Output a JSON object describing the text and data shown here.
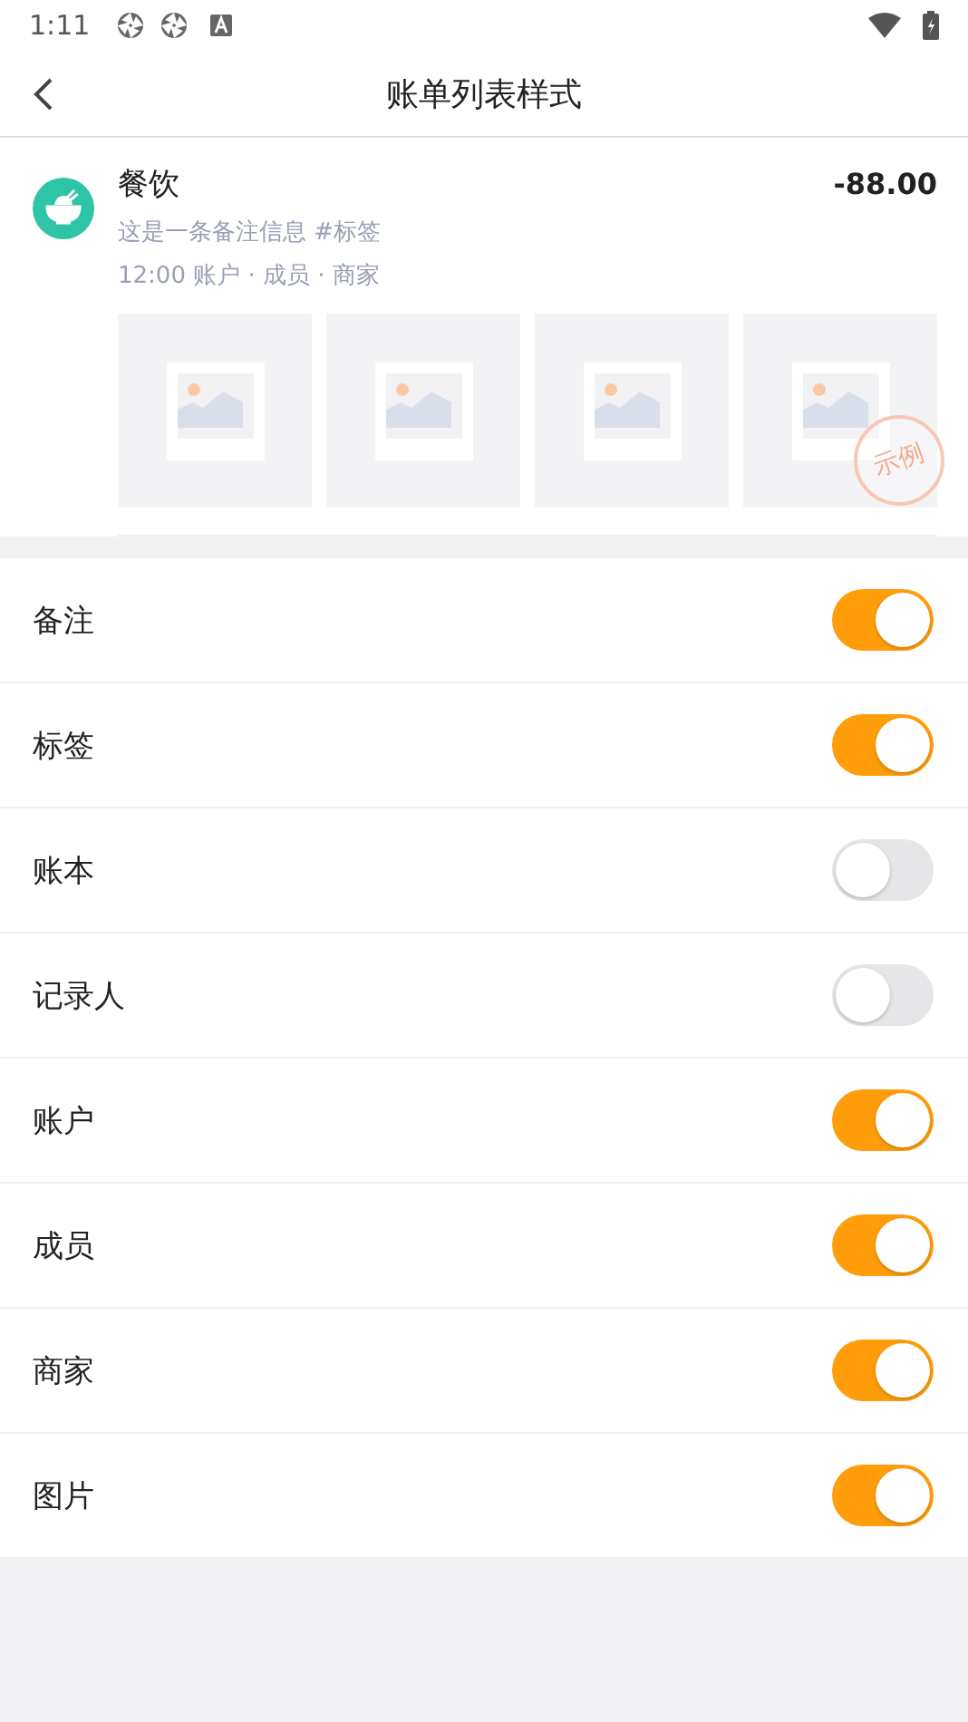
{
  "status_bar": {
    "time": "1:11"
  },
  "header": {
    "title": "账单列表样式"
  },
  "preview": {
    "category": "餐饮",
    "amount": "-88.00",
    "note": "这是一条备注信息 #标签",
    "meta": "12:00 账户 · 成员 · 商家",
    "stamp": "示例"
  },
  "settings": [
    {
      "label": "备注",
      "on": true
    },
    {
      "label": "标签",
      "on": true
    },
    {
      "label": "账本",
      "on": false
    },
    {
      "label": "记录人",
      "on": false
    },
    {
      "label": "账户",
      "on": true
    },
    {
      "label": "成员",
      "on": true
    },
    {
      "label": "商家",
      "on": true
    },
    {
      "label": "图片",
      "on": true
    }
  ]
}
